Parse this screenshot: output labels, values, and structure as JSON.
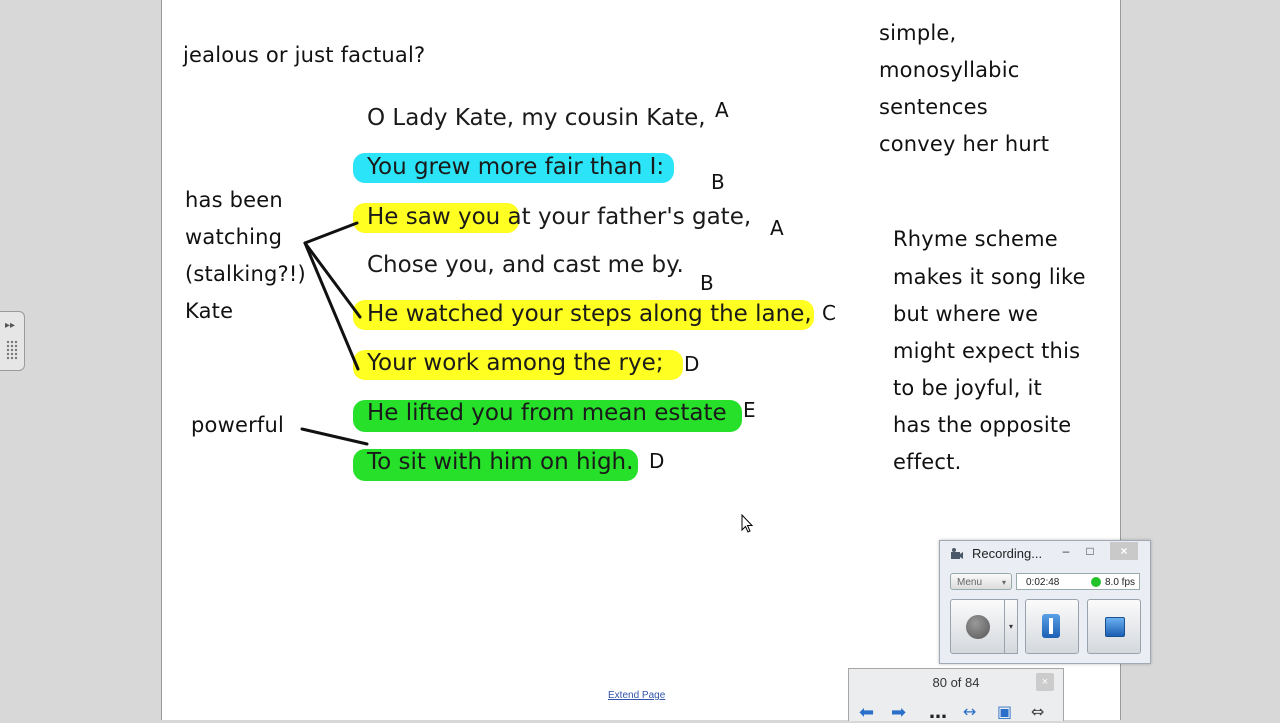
{
  "notes": {
    "question": "jealous or just factual?",
    "simple": [
      "simple,",
      "monosyllabic",
      "sentences",
      "convey her hurt"
    ],
    "watching": [
      "has been",
      "watching",
      "(stalking?!)",
      "Kate"
    ],
    "rhyme": [
      "Rhyme scheme",
      "makes it song like",
      "but where we",
      "might expect this",
      "to be joyful, it",
      "has the opposite",
      "effect."
    ],
    "powerful": "powerful"
  },
  "poem": {
    "lines": [
      "O Lady Kate, my cousin Kate,",
      "You grew more fair than I:",
      "He saw you at your father's gate,",
      "Chose you, and cast me by.",
      "He watched your steps along the lane,",
      "Your work among the rye;",
      "He lifted you from mean estate",
      "To sit with him on high."
    ],
    "rhyme_marks": [
      "A",
      "B",
      "A",
      "B",
      "C",
      "D",
      "E",
      "D"
    ]
  },
  "highlight_colors": {
    "cyan": "#2be4f7",
    "yellow": "#ffff22",
    "green": "#26e02a"
  },
  "extend_link": "Extend Page",
  "recorder": {
    "title": "Recording...",
    "minimize": "–",
    "maximize": "□",
    "close": "×",
    "menu": "Menu",
    "time": "0:02:48",
    "fps": "8.0 fps",
    "status_color": "#22c22a"
  },
  "page_nav": {
    "counter": "80 of 84",
    "close": "×"
  },
  "icons": [
    "previous-page-icon",
    "next-page-icon",
    "more-icon",
    "page-width-icon",
    "screen-icon",
    "resize-icon",
    "record-icon",
    "pause-icon",
    "stop-icon",
    "mouse-cursor-icon"
  ]
}
